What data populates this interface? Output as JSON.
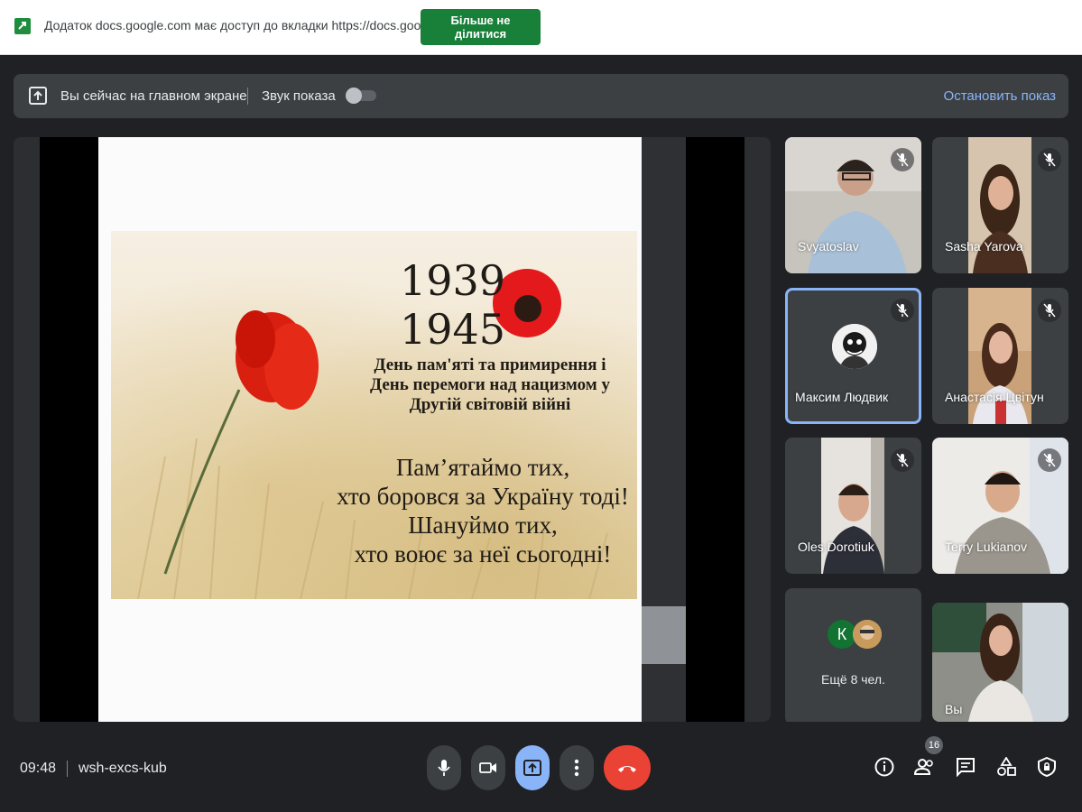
{
  "infobar": {
    "message": "Додаток docs.google.com має доступ до вкладки https://docs.google.com",
    "stop_sharing_label": "Більше не ділитися",
    "icon": "google-docs-icon"
  },
  "present_bar": {
    "status": "Вы сейчас на главном экране",
    "sound_label": "Звук показа",
    "sound_enabled": false,
    "stop_label": "Остановить показ"
  },
  "slide": {
    "year_start": "1939",
    "year_end": "1945",
    "day_title_line1": "День пам'яті та примирення і",
    "day_title_line2": "День перемоги над нацизмом у",
    "day_title_line3": "Другій світовій війні",
    "quote_line1": "Пам’ятаймо тих,",
    "quote_line2": "хто боровся за Україну тоді!",
    "quote_line3": "Шануймо тих,",
    "quote_line4": "хто воює за неї сьогодні!"
  },
  "participants": [
    {
      "name": "Svyatoslav",
      "muted": true
    },
    {
      "name": "Sasha Yarova",
      "muted": true
    },
    {
      "name": "Максим Людвик",
      "muted": true,
      "active": true
    },
    {
      "name": "Анастасія Цвітун",
      "muted": true
    },
    {
      "name": "Oles Dorotiuk",
      "muted": true
    },
    {
      "name": "Terry Lukianov",
      "muted": true
    },
    {
      "name": "Вы",
      "muted": false
    }
  ],
  "more_participants": {
    "initial": "К",
    "label": "Ещё 8 чел."
  },
  "bottom_bar": {
    "time": "09:48",
    "meeting_code": "wsh-excs-kub",
    "people_count": "16"
  },
  "colors": {
    "background": "#202124",
    "accent_blue": "#8ab4f8",
    "end_call_red": "#ea4335",
    "share_green": "#188038"
  }
}
